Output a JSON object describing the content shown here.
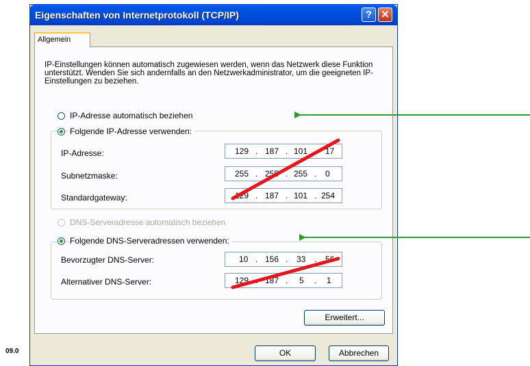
{
  "window": {
    "title": "Eigenschaften von Internetprotokoll (TCP/IP)",
    "help_symbol": "?",
    "close_symbol": "✕"
  },
  "tab": {
    "label": "Allgemein"
  },
  "description": "IP-Einstellungen können automatisch zugewiesen werden, wenn das Netzwerk diese Funktion unterstützt. Wenden Sie sich andernfalls an den Netzwerkadministrator, um die geeigneten IP-Einstellungen zu beziehen.",
  "ip_section": {
    "auto_label": "IP-Adresse automatisch beziehen",
    "manual_label": "Folgende IP-Adresse verwenden:",
    "selected": "manual",
    "fields": [
      {
        "label": "IP-Adresse:",
        "octets": [
          "129",
          "187",
          "101",
          "17"
        ]
      },
      {
        "label": "Subnetzmaske:",
        "octets": [
          "255",
          "255",
          "255",
          "0"
        ]
      },
      {
        "label": "Standardgateway:",
        "octets": [
          "129",
          "187",
          "101",
          "254"
        ]
      }
    ]
  },
  "dns_section": {
    "auto_label": "DNS-Serveradresse automatisch beziehen",
    "auto_disabled": true,
    "manual_label": "Folgende DNS-Serveradressen verwenden:",
    "selected": "manual",
    "fields": [
      {
        "label": "Bevorzugter DNS-Server:",
        "octets": [
          "10",
          "156",
          "33",
          "56"
        ]
      },
      {
        "label": "Alternativer DNS-Server:",
        "octets": [
          "129",
          "187",
          "5",
          "1"
        ]
      }
    ]
  },
  "buttons": {
    "advanced": "Erweitert...",
    "ok": "OK",
    "cancel": "Abbrechen"
  },
  "footer": {
    "date_fragment": "09.0"
  },
  "annotations": {
    "arrow_color": "#2e9b2e",
    "strike_color": "#e8141b"
  }
}
